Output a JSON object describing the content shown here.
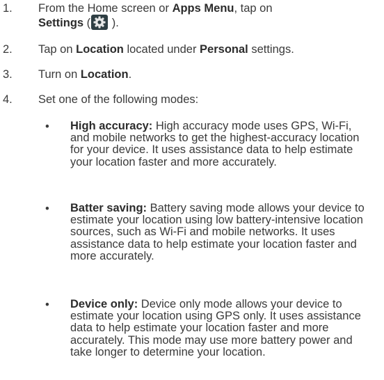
{
  "steps": [
    {
      "number": "1.",
      "part1": "From the Home screen or ",
      "bold1": "Apps Menu",
      "part2": ", tap on",
      "bold2": "Settings",
      "part3": " (",
      "part4": " )."
    },
    {
      "number": "2.",
      "part1": "Tap on ",
      "bold1": "Location",
      "part2": " located under ",
      "bold2": "Personal",
      "part3": " settings."
    },
    {
      "number": "3.",
      "part1": "Turn on ",
      "bold1": "Location",
      "part2": "."
    },
    {
      "number": "4.",
      "part1": "Set one of the following modes:"
    }
  ],
  "modes": [
    {
      "bullet": "•",
      "title": "High accuracy:",
      "body": " High accuracy mode uses GPS, Wi-Fi, and mobile networks to get the highest-accuracy location for your device. It uses assistance data to help estimate your location faster and more accurately."
    },
    {
      "bullet": "•",
      "title": "Batter saving:",
      "body": " Battery saving mode allows your device to estimate your location using low battery-intensive location sources, such as Wi-Fi and mobile networks. It uses assistance data to help estimate your location faster and more accurately."
    },
    {
      "bullet": "•",
      "title": "Device only:",
      "body": " Device only mode allows your device to estimate your location using GPS only. It uses assistance data to help estimate your location faster and more accurately. This mode may use more battery power and take longer to determine your location."
    }
  ],
  "icons": {
    "settings": "gear-icon",
    "settings_bg": "#2f3f44",
    "settings_fg": "#e8e8e8"
  }
}
